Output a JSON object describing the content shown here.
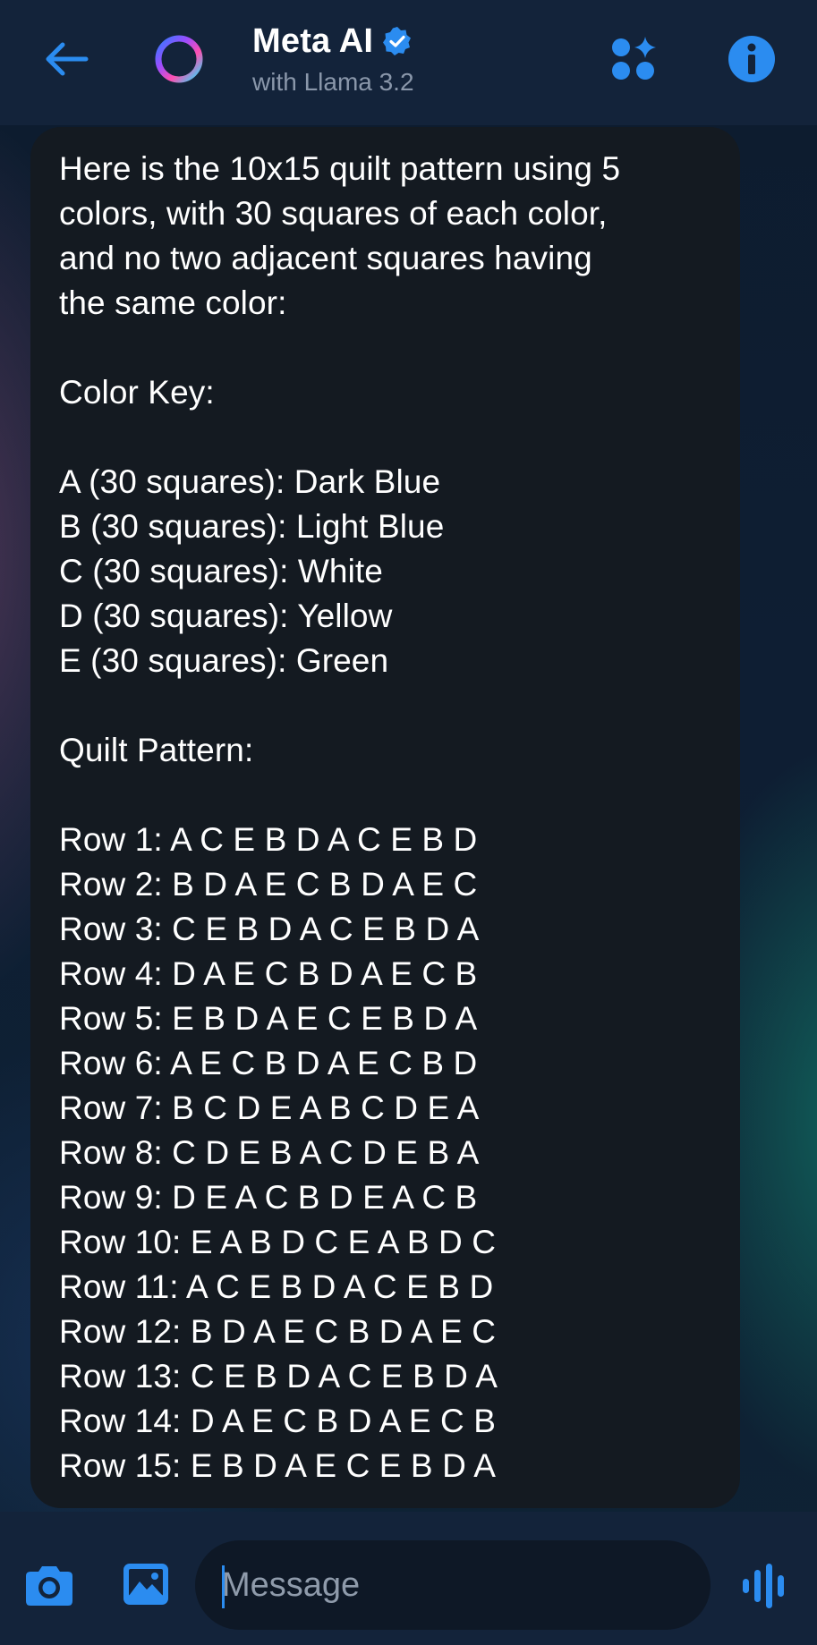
{
  "header": {
    "title": "Meta AI",
    "subtitle": "with Llama 3.2"
  },
  "message": {
    "intro": [
      "Here is the 10x15 quilt pattern using 5",
      "colors, with 30 squares of each color,",
      "and no two adjacent squares having",
      "the same color:"
    ],
    "color_key_heading": "Color Key:",
    "color_key": [
      "A (30 squares): Dark Blue",
      "B (30 squares): Light Blue",
      "C (30 squares): White",
      "D (30 squares): Yellow",
      "E (30 squares): Green"
    ],
    "pattern_heading": "Quilt Pattern:",
    "rows": [
      "Row 1: A C E B D A C E B D",
      "Row 2: B D A E C B D A E C",
      "Row 3: C E B D A C E B D A",
      "Row 4: D A E C B D A E C B",
      "Row 5: E B D A E C E B D A",
      "Row 6: A E C B D A E C B D",
      "Row 7: B C D E A B C D E A",
      "Row 8: C D E B A C D E B A",
      "Row 9: D E A C B D E A C B",
      "Row 10: E A B D C E A B D C",
      "Row 11: A C E B D A C E B D",
      "Row 12: B D A E C B D A E C",
      "Row 13: C E B D A C E B D A",
      "Row 14: D A E C B D A E C B",
      "Row 15: E B D A E C E B D A"
    ]
  },
  "composer": {
    "placeholder": "Message",
    "value": ""
  },
  "icons": {
    "back": "arrow-left-icon",
    "ai_logo": "meta-ai-ring-icon",
    "verified": "verified-badge-icon",
    "apps": "apps-sparkle-icon",
    "info": "info-icon",
    "camera": "camera-icon",
    "gallery": "gallery-icon",
    "voice": "voice-waveform-icon"
  },
  "colors": {
    "accent": "#2b8cf0",
    "header_bg": "#13233a",
    "bubble_bg": "#141a21",
    "subtitle": "#8a97aa"
  }
}
